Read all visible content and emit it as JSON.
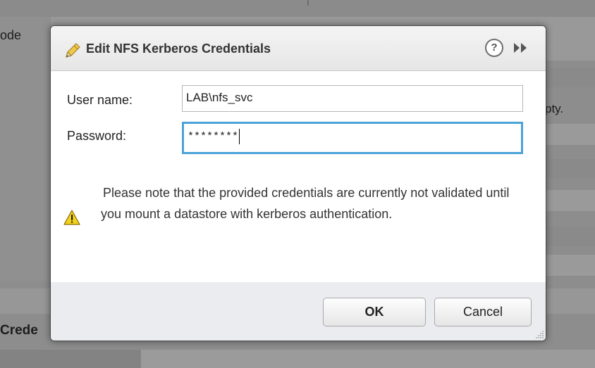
{
  "background": {
    "partial_label_top_left": "ode",
    "partial_label_right": "pty.",
    "partial_label_bottom_left": "Crede"
  },
  "dialog": {
    "title": "Edit NFS Kerberos Credentials",
    "title_icon": "pencil-icon",
    "help_icon": "help-icon",
    "help_glyph": "?",
    "collapse_icon": "double-chevron-right-icon",
    "fields": {
      "username_label": "User name:",
      "username_value": "LAB\\nfs_svc",
      "password_label": "Password:",
      "password_value": "********"
    },
    "note_icon": "warning-icon",
    "note": "Please note that the provided credentials are currently not validated until you mount a datastore with kerberos authentication.",
    "buttons": {
      "ok_label": "OK",
      "cancel_label": "Cancel"
    },
    "colors": {
      "focus_border": "#4aa3d8",
      "warning_fill": "#f5d21a"
    }
  }
}
